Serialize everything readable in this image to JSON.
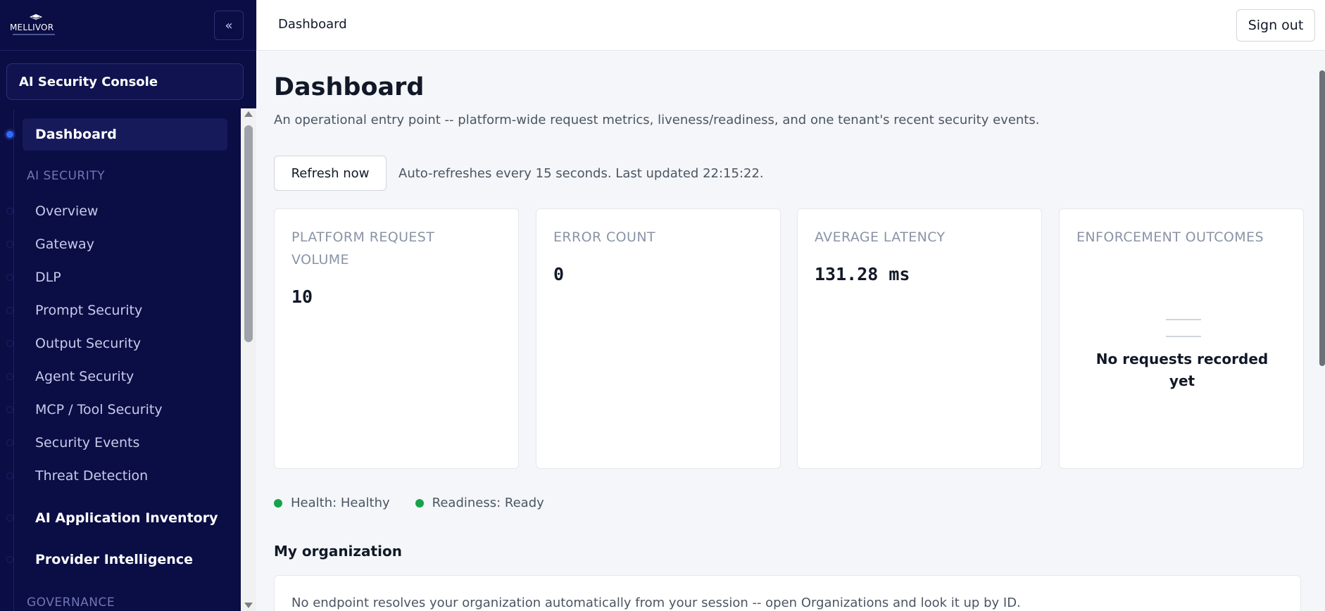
{
  "app": {
    "logo_text": "MELLIVOR",
    "console_label": "AI Security Console",
    "collapse_label": "«"
  },
  "sidebar": {
    "active": "Dashboard",
    "sections": {
      "ai_security": "AI SECURITY",
      "governance": "GOVERNANCE"
    },
    "items": [
      {
        "label": "Dashboard"
      },
      {
        "label": "Overview"
      },
      {
        "label": "Gateway"
      },
      {
        "label": "DLP"
      },
      {
        "label": "Prompt Security"
      },
      {
        "label": "Output Security"
      },
      {
        "label": "Agent Security"
      },
      {
        "label": "MCP / Tool Security"
      },
      {
        "label": "Security Events"
      },
      {
        "label": "Threat Detection"
      },
      {
        "label": "AI Application Inventory"
      },
      {
        "label": "Provider Intelligence"
      }
    ]
  },
  "header": {
    "breadcrumb": "Dashboard",
    "signout_label": "Sign out"
  },
  "main": {
    "title": "Dashboard",
    "subtitle": "An operational entry point -- platform-wide request metrics, liveness/readiness, and one tenant's recent security events.",
    "refresh_label": "Refresh now",
    "refresh_note": "Auto-refreshes every 15 seconds. Last updated 22:15:22.",
    "cards": [
      {
        "title": "PLATFORM REQUEST VOLUME",
        "value": "10"
      },
      {
        "title": "ERROR COUNT",
        "value": "0"
      },
      {
        "title": "AVERAGE LATENCY",
        "value": "131.28 ms"
      },
      {
        "title": "ENFORCEMENT OUTCOMES",
        "empty_text": "No requests recorded yet"
      }
    ],
    "health": {
      "label": "Health: Healthy",
      "color": "#16a34a"
    },
    "readiness": {
      "label": "Readiness: Ready",
      "color": "#16a34a"
    },
    "org_section_title": "My organization",
    "org_text": "No endpoint resolves your organization automatically from your session -- open Organizations and look it up by ID."
  },
  "colors": {
    "sidebar_bg": "#0b0d45",
    "accent": "#2f6bff",
    "status_ok": "#16a34a"
  }
}
